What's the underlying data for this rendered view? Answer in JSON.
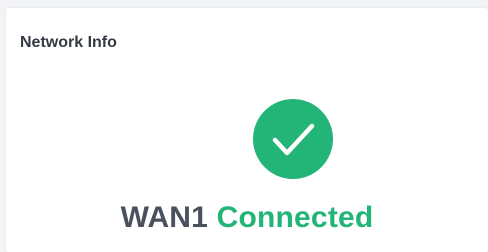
{
  "card": {
    "title": "Network Info"
  },
  "status": {
    "icon": "check-circle-icon",
    "icon_color": "#23b478",
    "wan_name": "WAN1",
    "state": "Connected",
    "state_color": "#23b478"
  }
}
